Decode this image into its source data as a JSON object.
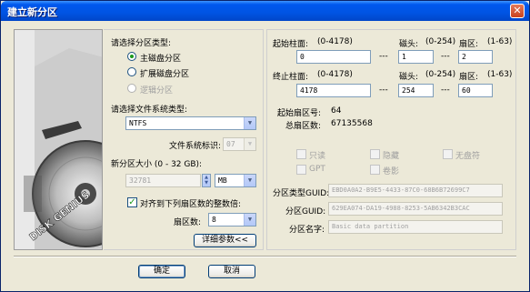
{
  "window": {
    "title": "建立新分区"
  },
  "partition_type": {
    "label": "请选择分区类型:",
    "options": [
      {
        "label": "主磁盘分区",
        "selected": true,
        "enabled": true
      },
      {
        "label": "扩展磁盘分区",
        "selected": false,
        "enabled": true
      },
      {
        "label": "逻辑分区",
        "selected": false,
        "enabled": false
      }
    ]
  },
  "filesystem": {
    "label": "请选择文件系统类型:",
    "value": "NTFS",
    "id_label": "文件系统标识:",
    "id_value": "07"
  },
  "size": {
    "label": "新分区大小 (0 - 32 GB):",
    "value": "32781",
    "unit": "MB"
  },
  "align": {
    "label": "对齐到下列扇区数的整数倍:",
    "checked": true,
    "sectors_label": "扇区数:",
    "sectors_value": "8"
  },
  "details_button": "详细参数<<",
  "start": {
    "cyl_label": "起始柱面:",
    "cyl_range": "(0-4178)",
    "cyl_value": "0",
    "head_label": "磁头:",
    "head_range": "(0-254)",
    "head_value": "1",
    "sector_label": "扇区:",
    "sector_range": "(1-63)",
    "sector_value": "2"
  },
  "end": {
    "cyl_label": "终止柱面:",
    "cyl_range": "(0-4178)",
    "cyl_value": "4178",
    "head_label": "磁头:",
    "head_range": "(0-254)",
    "head_value": "254",
    "sector_label": "扇区:",
    "sector_range": "(1-63)",
    "sector_value": "60"
  },
  "dash": "---",
  "info": {
    "start_sector_label": "起始扇区号:",
    "start_sector_value": "64",
    "total_sectors_label": "总扇区数:",
    "total_sectors_value": "67135568"
  },
  "attributes": {
    "readonly": "只读",
    "hidden": "隐藏",
    "no_drive_letter": "无盘符",
    "gpt": "GPT",
    "shadow": "卷影"
  },
  "guid": {
    "type_label": "分区类型GUID:",
    "type_value": "EBD0A0A2-B9E5-4433-87C0-68B6B72699C7",
    "part_label": "分区GUID:",
    "part_value": "629EA074-DA19-4988-8253-5AB6342B3CAC",
    "name_label": "分区名字:",
    "name_value": "Basic data partition"
  },
  "buttons": {
    "ok": "确定",
    "cancel": "取消"
  },
  "graphic_text": "DISK GENIUS"
}
